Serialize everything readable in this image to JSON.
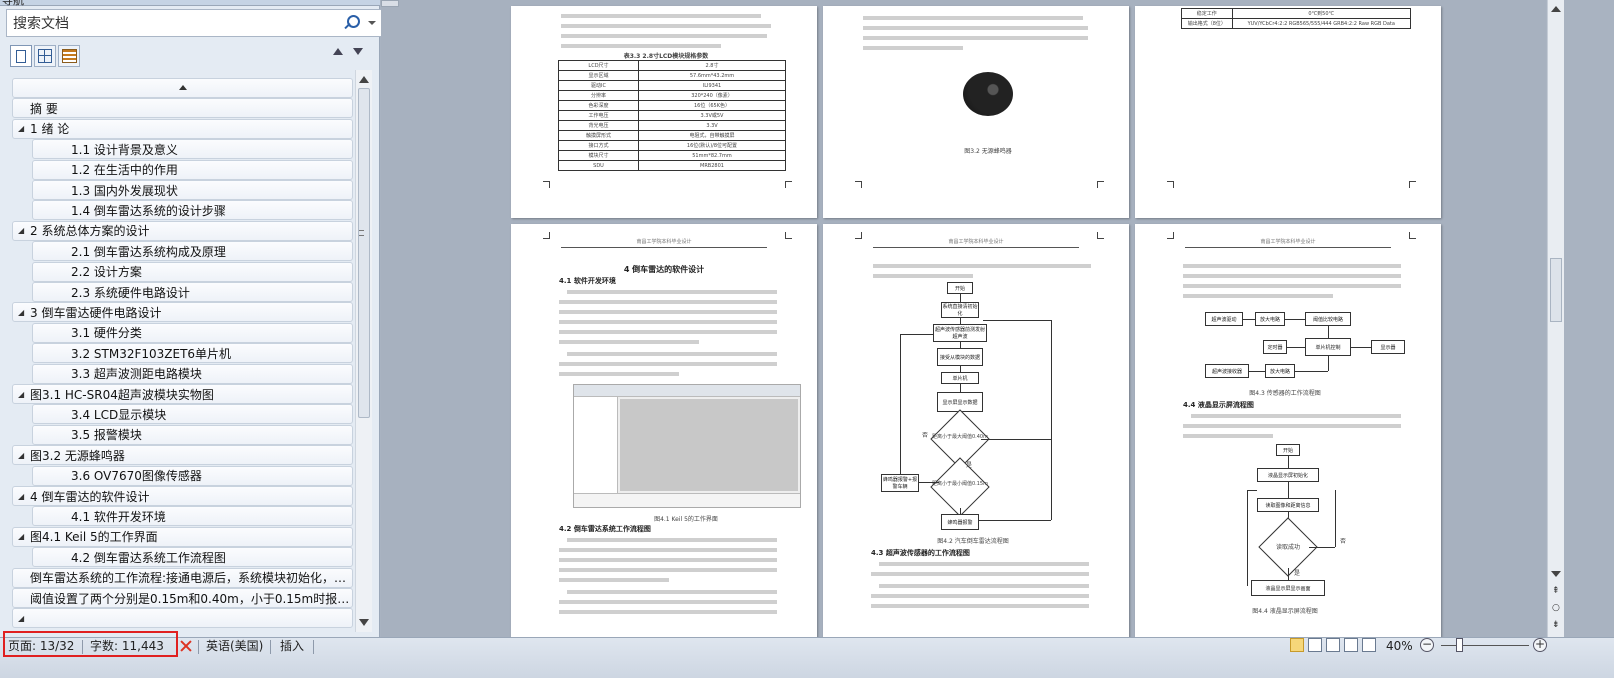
{
  "nav": {
    "title": "导航",
    "search_placeholder": "搜索文档",
    "items": [
      {
        "label": "",
        "type": "collapse-all",
        "level": 0
      },
      {
        "label": "摘 要",
        "level": 0,
        "toggle": ""
      },
      {
        "label": "1 绪 论",
        "level": 0,
        "toggle": "◢"
      },
      {
        "label": "1.1 设计背景及意义",
        "level": 1
      },
      {
        "label": "1.2 在生活中的作用",
        "level": 1
      },
      {
        "label": "1.3 国内外发展现状",
        "level": 1
      },
      {
        "label": "1.4 倒车雷达系统的设计步骤",
        "level": 1
      },
      {
        "label": "2 系统总体方案的设计",
        "level": 0,
        "toggle": "◢"
      },
      {
        "label": "2.1 倒车雷达系统构成及原理",
        "level": 1
      },
      {
        "label": "2.2 设计方案",
        "level": 1
      },
      {
        "label": "2.3 系统硬件电路设计",
        "level": 1
      },
      {
        "label": "3 倒车雷达硬件电路设计",
        "level": 0,
        "toggle": "◢"
      },
      {
        "label": "3.1 硬件分类",
        "level": 1
      },
      {
        "label": "3.2 STM32F103ZET6单片机",
        "level": 1
      },
      {
        "label": "3.3 超声波测距电路模块",
        "level": 1
      },
      {
        "label": "图3.1 HC-SR04超声波模块实物图",
        "level": 0,
        "toggle": "◢"
      },
      {
        "label": "3.4 LCD显示模块",
        "level": 1
      },
      {
        "label": "3.5 报警模块",
        "level": 1
      },
      {
        "label": "图3.2 无源蜂鸣器",
        "level": 0,
        "toggle": "◢"
      },
      {
        "label": "3.6 OV7670图像传感器",
        "level": 1
      },
      {
        "label": "4 倒车雷达的软件设计",
        "level": 0,
        "toggle": "◢"
      },
      {
        "label": "4.1 软件开发环境",
        "level": 1
      },
      {
        "label": "图4.1 Keil 5的工作界面",
        "level": 0,
        "toggle": "◢"
      },
      {
        "label": "4.2 倒车雷达系统工作流程图",
        "level": 1
      },
      {
        "label": "倒车雷达系统的工作流程:接通电源后，系统模块初始化，超...",
        "level": 0,
        "toggle": ""
      },
      {
        "label": "阈值设置了两个分别是0.15m和0.40m，小于0.15m时报警...",
        "level": 0,
        "toggle": ""
      },
      {
        "label": "",
        "level": 0,
        "toggle": "◢"
      }
    ]
  },
  "doc": {
    "p1_caption": "表3.3 2.8寸LCD模块规格参数",
    "p1_table": [
      [
        "LCD尺寸",
        "2.8寸"
      ],
      [
        "显示区域",
        "57.6mm*43.2mm"
      ],
      [
        "驱动IC",
        "ILI9341"
      ],
      [
        "分辨率",
        "320*240（像素）"
      ],
      [
        "色彩深度",
        "16位（65K色）"
      ],
      [
        "工作电压",
        "3.3V或5V"
      ],
      [
        "背光电压",
        "3.3V"
      ],
      [
        "触摸屏形式",
        "电阻式，自带触摸屏"
      ],
      [
        "接口方式",
        "16位(默认)/8位可配置"
      ],
      [
        "模块尺寸",
        "51mm*82.7mm"
      ],
      [
        "SDU",
        "MRB2801"
      ]
    ],
    "p2_caption": "图3.2 无源蜂鸣器",
    "p3_table": [
      [
        "稳定工作",
        "0℃到50℃"
      ],
      [
        "输出格式（8位）",
        "YUV/YCbCr4:2:2 RGB565/555/444 GRB4:2:2 Raw RGB Data"
      ]
    ],
    "p4_title": "4 倒车雷达的软件设计",
    "p4_h1": "4.1 软件开发环境",
    "p4_cap": "图4.1 Keil 5的工作界面",
    "p4_h2": "4.2 倒车雷达系统工作流程图",
    "p5_flow": [
      "开始",
      "系统直接清初始化",
      "超声波传感器前测发射超声波",
      "接受从模块的数据",
      "单片机",
      "显示屏显示数据",
      "距离小于最大阈值0.40m",
      "距离小于最小阈值0.15m",
      "蜂鸣器报警",
      "蜂鸣器报警+报警车辆"
    ],
    "p5_no": "否",
    "p5_yes": "是",
    "p5_cap": "图4.2 汽车倒车雷达流程图",
    "p5_h": "4.3 超声波传感器的工作流程图",
    "p6_flow": [
      "超声波驱动",
      "放大电路",
      "阈值比较电路",
      "定时器",
      "单片机控制",
      "显示器",
      "超声波接收器",
      "放大电路"
    ],
    "p6_cap1": "图4.3 传感器的工作流程图",
    "p6_h": "4.4 液晶显示屏流程图",
    "p6_flow2": [
      "开始",
      "液晶显示屏初始化",
      "读取图像和距离信息",
      "读取成功",
      "液晶显示屏显示画面"
    ],
    "p6_cap2": "图4.4 液晶显示屏流程图",
    "header_text": "南昌工学院本科毕业设计"
  },
  "status": {
    "page": "页面: 13/32",
    "words": "字数: 11,443",
    "language": "英语(美国)",
    "mode": "插入",
    "zoom": "40%",
    "zoom_fraction": 0.4
  }
}
